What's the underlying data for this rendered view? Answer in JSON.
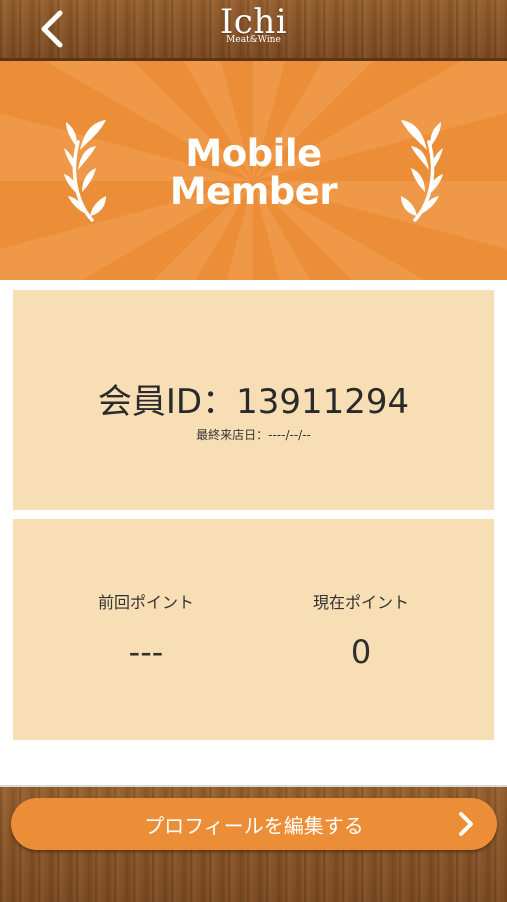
{
  "header": {
    "back_icon": "chevron-left-icon",
    "logo_main": "Ichi",
    "logo_sub": "Meat&Wine"
  },
  "banner": {
    "line1": "Mobile",
    "line2": "Member",
    "laurel_icon": "laurel-icon"
  },
  "member": {
    "id_text": "会員ID：13911294",
    "last_visit": "最終来店日：----/--/--"
  },
  "points": {
    "previous_label": "前回ポイント",
    "previous_value": "---",
    "current_label": "現在ポイント",
    "current_value": "0"
  },
  "footer": {
    "edit_profile_label": "プロフィールを編集する",
    "chevron_icon": "chevron-right-icon"
  },
  "colors": {
    "accent_orange": "#ec8d37",
    "card_beige": "#f8deb5",
    "wood_brown": "#8a5326"
  }
}
